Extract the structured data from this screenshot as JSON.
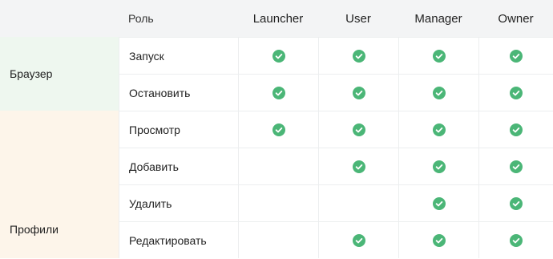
{
  "header": {
    "role_label": "Роль",
    "columns": [
      "Launcher",
      "User",
      "Manager",
      "Owner"
    ]
  },
  "groups": {
    "browser": "Браузер",
    "profiles": "Профили"
  },
  "rows": [
    {
      "label": "Запуск",
      "checks": [
        true,
        true,
        true,
        true
      ]
    },
    {
      "label": "Остановить",
      "checks": [
        true,
        true,
        true,
        true
      ]
    },
    {
      "label": "Просмотр",
      "checks": [
        true,
        true,
        true,
        true
      ]
    },
    {
      "label": "Добавить",
      "checks": [
        false,
        true,
        true,
        true
      ]
    },
    {
      "label": "Удалить",
      "checks": [
        false,
        false,
        true,
        true
      ]
    },
    {
      "label": "Редактировать",
      "checks": [
        false,
        true,
        true,
        true
      ]
    }
  ],
  "colors": {
    "check_green": "#4bb677",
    "browser_bg": "#eef7ef",
    "profiles_bg": "#fdf5ea",
    "header_bg": "#f3f4f5"
  },
  "icons": {
    "check": "check-circle-icon"
  }
}
